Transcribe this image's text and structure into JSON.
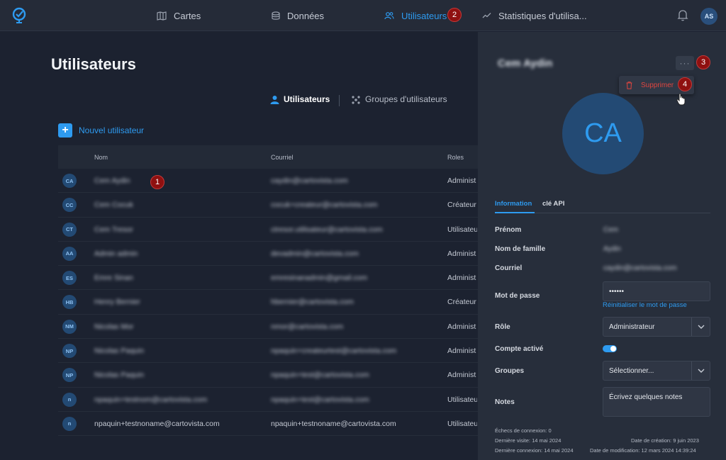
{
  "topbar": {
    "nav": [
      {
        "label": "Cartes",
        "icon": "map-icon"
      },
      {
        "label": "Données",
        "icon": "database-icon"
      },
      {
        "label": "Utilisateurs",
        "icon": "users-icon"
      },
      {
        "label": "Statistiques d'utilisa...",
        "icon": "chart-line-icon"
      }
    ],
    "avatar": "AS"
  },
  "badges": [
    "1",
    "2",
    "3",
    "4"
  ],
  "main": {
    "title": "Utilisateurs",
    "subtabs": [
      "Utilisateurs",
      "Groupes d'utilisateurs"
    ],
    "new_user": "Nouvel utilisateur",
    "columns": [
      "Nom",
      "Courriel",
      "Roles"
    ],
    "rows": [
      {
        "initials": "CA",
        "name": "Cem Aydin",
        "email": "caydin@cartovista.com",
        "role": "Administ"
      },
      {
        "initials": "CC",
        "name": "Cem Cocuk",
        "email": "cocuk+createur@cartovista.com",
        "role": "Créateur"
      },
      {
        "initials": "CT",
        "name": "Cem Tresor",
        "email": "ctresor.utilisateur@cartovista.com",
        "role": "Utilisateu"
      },
      {
        "initials": "AA",
        "name": "Admin admin",
        "email": "devadmin@cartovista.com",
        "role": "Administ"
      },
      {
        "initials": "ES",
        "name": "Emre Sinan",
        "email": "emresinanadmin@gmail.com",
        "role": "Administ"
      },
      {
        "initials": "HB",
        "name": "Henry Bernier",
        "email": "hbernier@cartovista.com",
        "role": "Créateur"
      },
      {
        "initials": "NM",
        "name": "Nicolas Mor",
        "email": "nmor@cartovista.com",
        "role": "Administ"
      },
      {
        "initials": "NP",
        "name": "Nicolas Paquin",
        "email": "npaquin+createurtest@cartovista.com",
        "role": "Administ"
      },
      {
        "initials": "NP",
        "name": "Nicolas Paquin",
        "email": "npaquin+test@cartovista.com",
        "role": "Administ"
      },
      {
        "initials": "n",
        "name": "npaquin+testnom@cartovista.com",
        "email": "npaquin+test@cartovista.com",
        "role": "Utilisateu"
      },
      {
        "initials": "n",
        "name": "npaquin+testnoname@cartovista.com",
        "email": "npaquin+testnoname@cartovista.com",
        "role": "Utilisateu"
      }
    ]
  },
  "panel": {
    "name": "Cem Aydin",
    "more": "···",
    "menu_delete": "Supprimer",
    "avatar": "CA",
    "tabs": [
      "Information",
      "clé API"
    ],
    "fields": {
      "prenom_label": "Prénom",
      "prenom": "Cem",
      "nom_label": "Nom de famille",
      "nom": "Aydin",
      "courriel_label": "Courriel",
      "courriel": "caydin@cartovista.com",
      "mdp_label": "Mot de passe",
      "mdp": "••••••",
      "reset_link": "Réinitialiser le mot de passe",
      "role_label": "Rôle",
      "role": "Administrateur",
      "actif_label": "Compte activé",
      "groupes_label": "Groupes",
      "groupes": "Sélectionner...",
      "notes_label": "Notes",
      "notes_placeholder": "Écrivez quelques notes"
    },
    "meta": {
      "echecs": "Échecs de connexion: 0",
      "visite": "Dernière visite: 14 mai 2024",
      "creation": "Date de création: 9 juin 2023",
      "connexion": "Dernière connexion: 14 mai 2024",
      "modification": "Date de modification: 12 mars 2024 14:39:24"
    }
  }
}
